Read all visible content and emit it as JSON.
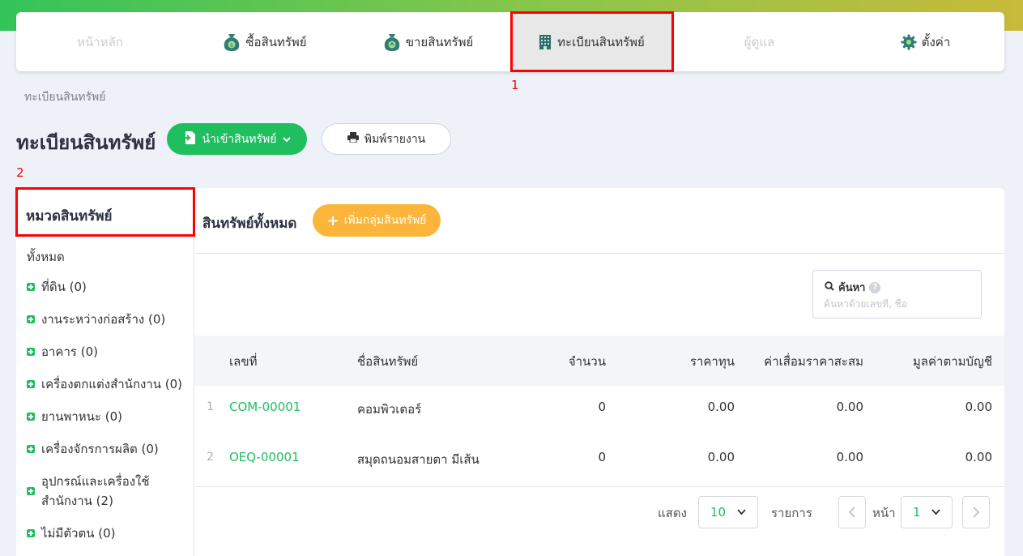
{
  "nav": {
    "items": [
      {
        "label": "หน้าหลัก",
        "icon": "home-icon",
        "state": "disabled"
      },
      {
        "label": "ซื้อสินทรัพย์",
        "icon": "money-bag-icon",
        "state": "normal"
      },
      {
        "label": "ขายสินทรัพย์",
        "icon": "money-bag-sell-icon",
        "state": "normal"
      },
      {
        "label": "ทะเบียนสินทรัพย์",
        "icon": "building-icon",
        "state": "active"
      },
      {
        "label": "ผู้ดูแล",
        "icon": "user-icon",
        "state": "disabled"
      },
      {
        "label": "ตั้งค่า",
        "icon": "gear-icon",
        "state": "normal"
      }
    ]
  },
  "annotations": [
    "1",
    "2"
  ],
  "breadcrumb": "ทะเบียนสินทรัพย์",
  "page_title": "ทะเบียนสินทรัพย์",
  "toolbar": {
    "import_label": "นำเข้าสินทรัพย์",
    "print_label": "พิมพ์รายงาน"
  },
  "sidebar": {
    "title": "หมวดสินทรัพย์",
    "all_label": "ทั้งหมด",
    "items": [
      {
        "label": "ที่ดิน (0)"
      },
      {
        "label": "งานระหว่างก่อสร้าง (0)"
      },
      {
        "label": "อาคาร (0)"
      },
      {
        "label": "เครื่องตกแต่งสำนักงาน (0)"
      },
      {
        "label": "ยานพาหนะ (0)"
      },
      {
        "label": "เครื่องจักรการผลิต (0)"
      },
      {
        "label": "อุปกรณ์และเครื่องใช้สำนักงาน (2)"
      },
      {
        "label": "ไม่มีตัวตน (0)"
      }
    ]
  },
  "content": {
    "title": "สินทรัพย์ทั้งหมด",
    "add_group_label": "เพิ่มกลุ่มสินทรัพย์"
  },
  "search": {
    "label": "ค้นหา",
    "placeholder": "ค้นหาด้วยเลขที่, ชื่อ",
    "value": ""
  },
  "table": {
    "columns": [
      "เลขที่",
      "ชื่อสินทรัพย์",
      "จำนวน",
      "ราคาทุน",
      "ค่าเสื่อมราคาสะสม",
      "มูลค่าตามบัญชี"
    ],
    "rows": [
      {
        "index": "1",
        "code": "COM-00001",
        "name": "คอมพิวเตอร์",
        "qty": "0",
        "cost": "0.00",
        "depreciation": "0.00",
        "book_value": "0.00"
      },
      {
        "index": "2",
        "code": "OEQ-00001",
        "name": "สมุดถนอมสายตา มีเส้น",
        "qty": "0",
        "cost": "0.00",
        "depreciation": "0.00",
        "book_value": "0.00"
      }
    ]
  },
  "pager": {
    "show_label": "แสดง",
    "page_size": "10",
    "items_label": "รายการ",
    "page_label": "หน้า",
    "page": "1"
  },
  "colors": {
    "accent_green": "#1fbf60",
    "accent_orange": "#fcb53b",
    "annotation_red": "#ff0000"
  }
}
